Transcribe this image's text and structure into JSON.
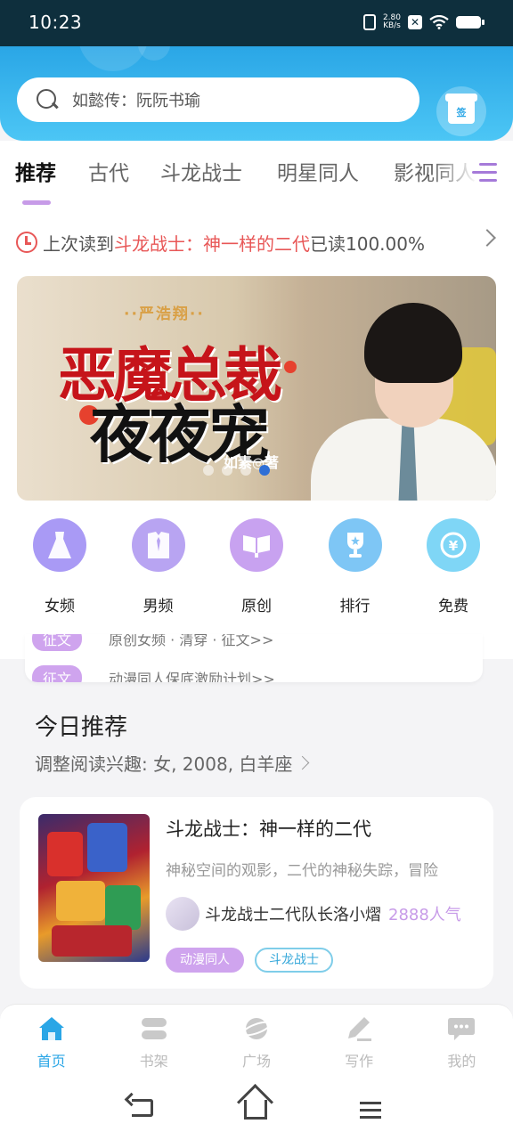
{
  "status_bar": {
    "time": "10:23",
    "net_speed_value": "2.80",
    "net_speed_unit": "KB/s"
  },
  "header": {
    "search_placeholder": "如懿传：阮阮书瑜",
    "sign_in_label": "签"
  },
  "tabs": [
    {
      "label": "推荐",
      "active": true
    },
    {
      "label": "古代",
      "active": false
    },
    {
      "label": "斗龙战士",
      "active": false
    },
    {
      "label": "明星同人",
      "active": false
    },
    {
      "label": "影视同人",
      "active": false
    }
  ],
  "last_read": {
    "prefix": "上次读到",
    "book": "斗龙战士：神一样的二代",
    "suffix": "已读100.00%"
  },
  "banner": {
    "author_top": "··严浩翔··",
    "title_line1": "恶魔总裁",
    "title_line2": "夜夜宠",
    "author_bottom": "如素◎著",
    "slide_count": 4,
    "active_slide": 4
  },
  "categories": [
    {
      "label": "女频",
      "icon": "dress-icon",
      "color": "#a99af5"
    },
    {
      "label": "男频",
      "icon": "shirt-icon",
      "color": "#b8a4f2"
    },
    {
      "label": "原创",
      "icon": "open-book-icon",
      "color": "#c8a2f0"
    },
    {
      "label": "排行",
      "icon": "trophy-icon",
      "color": "#7ec6f5"
    },
    {
      "label": "免费",
      "icon": "coin-icon",
      "color": "#7fd6f6"
    }
  ],
  "announcements": [
    {
      "tag": "征文",
      "text": "原创女频 · 清穿 · 征文>>"
    },
    {
      "tag": "征文",
      "text": "动漫同人保底激励计划>>"
    }
  ],
  "today": {
    "title": "今日推荐",
    "subtitle": "调整阅读兴趣: 女, 2008, 白羊座"
  },
  "book": {
    "title": "斗龙战士：神一样的二代",
    "description": "神秘空间的观影，二代的神秘失踪，冒险",
    "author": "斗龙战士二代队长洛小熠",
    "popularity": "2888人气",
    "tags": [
      "动漫同人",
      "斗龙战士"
    ]
  },
  "bottom_nav": [
    {
      "label": "首页",
      "icon": "home-icon",
      "active": true
    },
    {
      "label": "书架",
      "icon": "bookshelf-icon",
      "active": false
    },
    {
      "label": "广场",
      "icon": "planet-icon",
      "active": false
    },
    {
      "label": "写作",
      "icon": "pen-icon",
      "active": false
    },
    {
      "label": "我的",
      "icon": "chat-bubble-icon",
      "active": false
    }
  ],
  "colors": {
    "accent_blue": "#2aa6e6",
    "accent_purple": "#c79be8",
    "highlight_red": "#e85757"
  }
}
